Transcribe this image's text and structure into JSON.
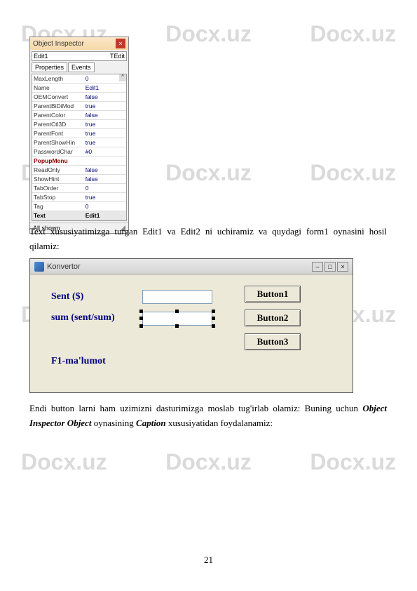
{
  "watermark": "Docx.uz",
  "object_inspector": {
    "title": "Object Inspector",
    "combo_left": "Edit1",
    "combo_right": "TEdit",
    "tabs": {
      "properties": "Properties",
      "events": "Events"
    },
    "rows": [
      {
        "prop": "MaxLength",
        "val": "0"
      },
      {
        "prop": "Name",
        "val": "Edit1"
      },
      {
        "prop": "OEMConvert",
        "val": "false"
      },
      {
        "prop": "ParentBiDiMod",
        "val": "true"
      },
      {
        "prop": "ParentColor",
        "val": "false"
      },
      {
        "prop": "ParentCtl3D",
        "val": "true"
      },
      {
        "prop": "ParentFont",
        "val": "true"
      },
      {
        "prop": "ParentShowHin",
        "val": "true"
      },
      {
        "prop": "PasswordChar",
        "val": "#0"
      },
      {
        "prop": "PopupMenu",
        "val": "",
        "red": true
      },
      {
        "prop": "ReadOnly",
        "val": "false"
      },
      {
        "prop": "ShowHint",
        "val": "false"
      },
      {
        "prop": "TabOrder",
        "val": "0"
      },
      {
        "prop": "TabStop",
        "val": "true"
      },
      {
        "prop": "Tag",
        "val": "0"
      },
      {
        "prop": "Text",
        "val": "Edit1",
        "selected": true
      }
    ],
    "status": "All shown"
  },
  "paragraphs": {
    "p1": "Text xususiyatimizga turgan Edit1 va Edit2 ni uchiramiz va quydagi form1 oynasini hosil qilamiz:",
    "p2_prefix": "Endi button larni ham uzimizni dasturimizga moslab tug'irlab olamiz: Buning uchun ",
    "p2_bold1": "Object Inspector Object",
    "p2_mid": " oynasining ",
    "p2_bold2": "Caption",
    "p2_suffix": " xususiyatidan foydalanamiz:"
  },
  "form": {
    "title": "Konvertor",
    "labels": {
      "sent": "Sent ($)",
      "sum": "sum (sent/sum)",
      "f1": "F1-ma'lumot"
    },
    "buttons": {
      "b1": "Button1",
      "b2": "Button2",
      "b3": "Button3"
    }
  },
  "page_number": "21"
}
